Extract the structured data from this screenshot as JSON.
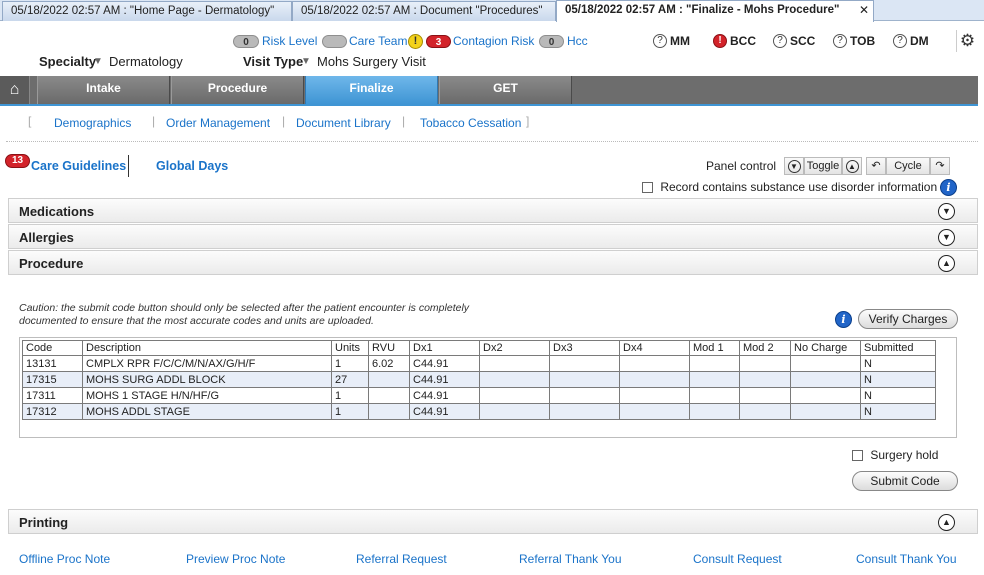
{
  "window_tabs": [
    {
      "label": "05/18/2022 02:57 AM : \"Home Page - Dermatology\"",
      "active": false
    },
    {
      "label": "05/18/2022 02:57 AM : Document \"Procedures\"",
      "active": false
    },
    {
      "label": "05/18/2022 02:57 AM : \"Finalize - Mohs Procedure\"",
      "active": true
    }
  ],
  "status": {
    "risk_level": {
      "count": "0",
      "label": "Risk Level"
    },
    "care_team": {
      "label": "Care Team"
    },
    "warning_glyph": "!",
    "contagion_risk": {
      "count": "3",
      "label": "Contagion Risk"
    },
    "hcc": {
      "count": "0",
      "label": "Hcc"
    },
    "indicators": [
      {
        "label": "MM",
        "icon": "question-icon"
      },
      {
        "label": "BCC",
        "icon": "alert-red-icon"
      },
      {
        "label": "SCC",
        "icon": "question-icon"
      },
      {
        "label": "TOB",
        "icon": "question-icon"
      },
      {
        "label": "DM",
        "icon": "question-icon"
      }
    ]
  },
  "specialty": {
    "label": "Specialty",
    "value": "Dermatology"
  },
  "visit_type": {
    "label": "Visit Type",
    "value": "Mohs Surgery Visit"
  },
  "nav_tabs": [
    {
      "label": "Intake",
      "active": false
    },
    {
      "label": "Procedure",
      "active": false
    },
    {
      "label": "Finalize",
      "active": true
    },
    {
      "label": "GET",
      "active": false
    }
  ],
  "sub_links": [
    "Demographics",
    "Order Management",
    "Document Library",
    "Tobacco Cessation"
  ],
  "care_guidelines": {
    "badge": "13",
    "label": "Care Guidelines"
  },
  "global_days": "Global Days",
  "panel_control": {
    "label": "Panel control",
    "toggle": "Toggle",
    "cycle": "Cycle"
  },
  "substance_checkbox": {
    "label": "Record contains substance use disorder information",
    "checked": false
  },
  "sections": {
    "medications": "Medications",
    "allergies": "Allergies",
    "procedure": "Procedure",
    "printing": "Printing"
  },
  "caution_text": "Caution: the submit code button should only be selected after the patient encounter is completely documented to ensure that the most accurate codes and units are uploaded.",
  "verify_charges": "Verify Charges",
  "charges_table": {
    "columns": [
      "Code",
      "Description",
      "Units",
      "RVU",
      "Dx1",
      "Dx2",
      "Dx3",
      "Dx4",
      "Mod 1",
      "Mod 2",
      "No Charge",
      "Submitted"
    ],
    "rows": [
      [
        "13131",
        "CMPLX RPR F/C/C/M/N/AX/G/H/F",
        "1",
        "6.02",
        "C44.91",
        "",
        "",
        "",
        "",
        "",
        "",
        "N"
      ],
      [
        "17315",
        "MOHS SURG ADDL BLOCK",
        "27",
        "",
        "C44.91",
        "",
        "",
        "",
        "",
        "",
        "",
        "N"
      ],
      [
        "17311",
        "MOHS 1 STAGE H/N/HF/G",
        "1",
        "",
        "C44.91",
        "",
        "",
        "",
        "",
        "",
        "",
        "N"
      ],
      [
        "17312",
        "MOHS ADDL STAGE",
        "1",
        "",
        "C44.91",
        "",
        "",
        "",
        "",
        "",
        "",
        "N"
      ]
    ]
  },
  "surgery_hold": {
    "label": "Surgery hold",
    "checked": false
  },
  "submit_code": "Submit Code",
  "footer_links": [
    "Offline Proc Note",
    "Preview Proc Note",
    "Referral Request",
    "Referral Thank You",
    "Consult Request",
    "Consult Thank You"
  ]
}
